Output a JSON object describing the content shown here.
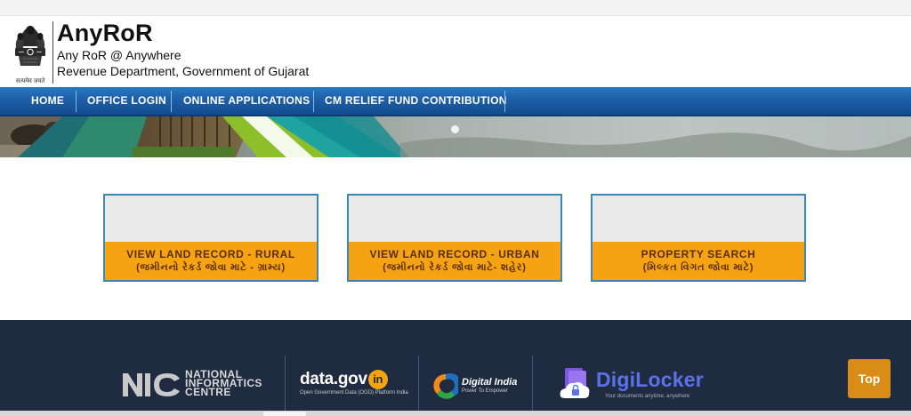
{
  "header": {
    "app_name": "AnyRoR",
    "tagline": "Any RoR @ Anywhere",
    "department": "Revenue Department, Government of Gujarat",
    "emblem_motto": "सत्यमेव जयते",
    "emblem_icon": "state-emblem-icon"
  },
  "nav": {
    "items": [
      {
        "label": "HOME"
      },
      {
        "label": "OFFICE LOGIN"
      },
      {
        "label": "ONLINE APPLICATIONS"
      },
      {
        "label": "CM RELIEF FUND CONTRIBUTION"
      }
    ]
  },
  "cards": [
    {
      "title": "VIEW LAND RECORD - RURAL",
      "subtitle": "(જમીનનો રેકર્ડ જોવા માટે - ગ્રામ્ય)"
    },
    {
      "title": "VIEW LAND RECORD - URBAN",
      "subtitle": "(જમીનનો રેકર્ડ જોવા માટે- શહેર)"
    },
    {
      "title": "PROPERTY SEARCH",
      "subtitle": "(મિલ્કત વિગત જોવા માટે)"
    }
  ],
  "footer": {
    "nic_line1": "NATIONAL",
    "nic_line2": "INFORMATICS",
    "nic_line3": "CENTRE",
    "datagov_main": "data.gov",
    "datagov_in": "in",
    "datagov_sub": "Open Government Data (OGD) Platform India",
    "digital_india_title": "Digital India",
    "digital_india_sub": "Power To Empower",
    "digilocker_title": "DigiLocker",
    "digilocker_sub": "Your documents anytime, anywhere",
    "top_button": "Top"
  },
  "colors": {
    "nav_blue": "#1d5fa8",
    "card_orange": "#f5a313",
    "card_border": "#3b87b8",
    "footer_bg": "#1e2b40",
    "top_button": "#d98c17"
  }
}
